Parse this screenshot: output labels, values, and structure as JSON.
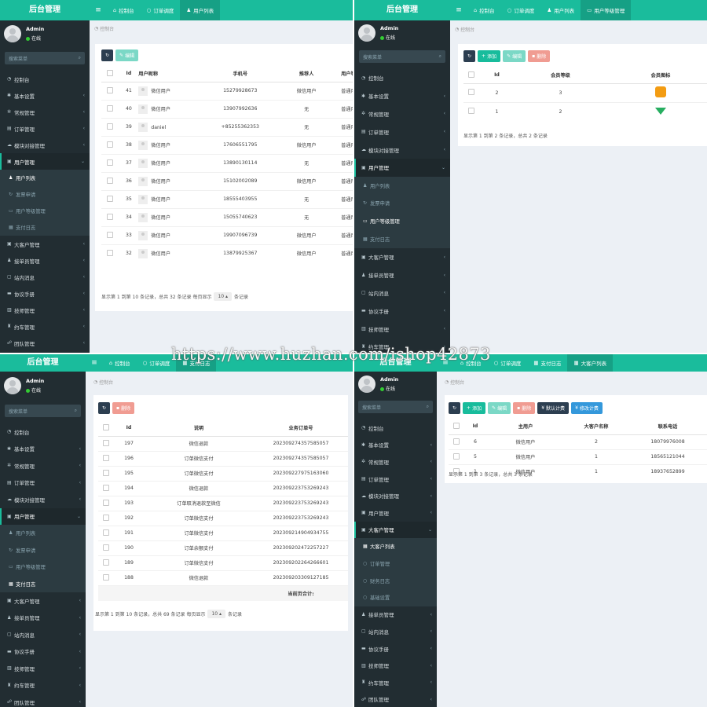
{
  "app_title": "后台管理",
  "user": {
    "name": "Admin",
    "status": "在线"
  },
  "search_placeholder": "搜索菜单",
  "breadcrumb": "控制台",
  "menu": {
    "dashboard": "控制台",
    "basic": "基本设置",
    "general": "常规管理",
    "orders": "订单管理",
    "modules": "模块对接管理",
    "users": "用户管理",
    "user_list": "用户列表",
    "withdraw": "发票申请",
    "user_level": "用户等级管理",
    "pay_log": "支付日志",
    "big_customer": "大客户管理",
    "receiver": "接单员管理",
    "messages": "站内消息",
    "agreement": "协议手册",
    "tech": "技师管理",
    "car": "约车管理",
    "team": "团队管理",
    "big_customer_list": "大客户列表",
    "order_mgmt": "订单管理",
    "finance_log": "财务日志",
    "basic_settings": "基础设置"
  },
  "q1": {
    "tabs": [
      "控制台",
      "订单调度",
      "用户列表"
    ],
    "toolbar": {
      "edit": "编辑"
    },
    "columns": [
      "Id",
      "用户昵称",
      "手机号",
      "推荐人",
      "用户等级"
    ],
    "rows": [
      {
        "id": "41",
        "nick": "微信用户",
        "phone": "15279928673",
        "ref": "微信用户",
        "level": "普通用户"
      },
      {
        "id": "40",
        "nick": "微信用户",
        "phone": "13907992636",
        "ref": "无",
        "level": "普通用户"
      },
      {
        "id": "39",
        "nick": "daniel",
        "phone": "+85255362353",
        "ref": "无",
        "level": "普通用户"
      },
      {
        "id": "38",
        "nick": "微信用户",
        "phone": "17606551795",
        "ref": "微信用户",
        "level": "普通用户"
      },
      {
        "id": "37",
        "nick": "微信用户",
        "phone": "13890130114",
        "ref": "无",
        "level": "普通用户"
      },
      {
        "id": "36",
        "nick": "微信用户",
        "phone": "15102002089",
        "ref": "微信用户",
        "level": "普通用户"
      },
      {
        "id": "35",
        "nick": "微信用户",
        "phone": "18555403955",
        "ref": "无",
        "level": "普通用户"
      },
      {
        "id": "34",
        "nick": "微信用户",
        "phone": "15055740623",
        "ref": "无",
        "level": "普通用户"
      },
      {
        "id": "33",
        "nick": "微信用户",
        "phone": "19907096739",
        "ref": "微信用户",
        "level": "普通用户"
      },
      {
        "id": "32",
        "nick": "微信用户",
        "phone": "13879925367",
        "ref": "微信用户",
        "level": "普通用户"
      }
    ],
    "footer": {
      "text": "显示第 1 到第 10 条记录，总共 32 条记录 每页显示",
      "page_size": "10",
      "suffix": "条记录"
    }
  },
  "q2": {
    "tabs": [
      "控制台",
      "订单调度",
      "用户列表",
      "用户等级管理"
    ],
    "toolbar": {
      "add": "添加",
      "edit": "编辑",
      "delete": "删除"
    },
    "columns": [
      "Id",
      "会员等级",
      "会员图标"
    ],
    "rows": [
      {
        "id": "2",
        "level": "3",
        "icon_color": "#f39c12"
      },
      {
        "id": "1",
        "level": "2",
        "icon_color": "#27ae60"
      }
    ],
    "footer": "显示第 1 到第 2 条记录，总共 2 条记录"
  },
  "q3": {
    "tabs": [
      "控制台",
      "订单调度",
      "支付日志"
    ],
    "toolbar": {
      "delete": "删除"
    },
    "columns": [
      "Id",
      "说明",
      "业务订单号"
    ],
    "rows": [
      {
        "id": "197",
        "desc": "微信退款",
        "order": "20230927435758505​7"
      },
      {
        "id": "196",
        "desc": "订单微信支付",
        "order": "202309274357585057"
      },
      {
        "id": "195",
        "desc": "订单微信支付",
        "order": "202309227975163060"
      },
      {
        "id": "194",
        "desc": "微信退款",
        "order": "202309223753269243"
      },
      {
        "id": "193",
        "desc": "订单取消退款至微信",
        "order": "202309223753269243"
      },
      {
        "id": "192",
        "desc": "订单微信支付",
        "order": "202309223753269243"
      },
      {
        "id": "191",
        "desc": "订单微信支付",
        "order": "202309214904934755"
      },
      {
        "id": "190",
        "desc": "订单余额支付",
        "order": "202309202472257227"
      },
      {
        "id": "189",
        "desc": "订单微信支付",
        "order": "202309202264266601"
      },
      {
        "id": "188",
        "desc": "微信退款",
        "order": "202309203309127185"
      }
    ],
    "summary": "当前页合计:",
    "footer": {
      "text": "显示第 1 到第 10 条记录，总共 69 条记录 每页显示",
      "page_size": "10",
      "suffix": "条记录"
    }
  },
  "q4": {
    "tabs": [
      "控制台",
      "订单调度",
      "支付日志",
      "大客户列表"
    ],
    "toolbar": {
      "add": "添加",
      "edit": "编辑",
      "delete": "删除",
      "default_pay": "默认计费",
      "modify_pay": "修改计费"
    },
    "columns": [
      "Id",
      "主用户",
      "大客户名称",
      "联系电话"
    ],
    "rows": [
      {
        "id": "6",
        "user": "微信用户",
        "name": "2",
        "phone": "18079976008"
      },
      {
        "id": "5",
        "user": "微信用户",
        "name": "1",
        "phone": "18565121044"
      },
      {
        "id": "1",
        "user": "微信用户",
        "name": "1",
        "phone": "18937652899"
      }
    ],
    "footer": "显示第 1 到第 3 条记录，总共 3 条记录"
  },
  "watermark": "https://www.huzhan.com/ishop42873"
}
